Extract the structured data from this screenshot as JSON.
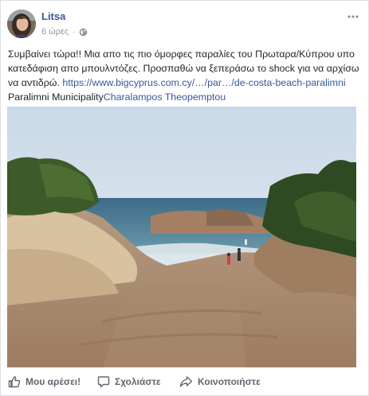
{
  "post": {
    "author": "Litsa",
    "time": "6 ώρες",
    "separator": "·",
    "text_main": "Συμβαίνει τώρα!! Μια απο τις πιο όμορφες παραλίες του Πρωταρα/Κύπρου υπο κατεδάφιση απο μπουλντόζες. Προσπαθώ να ξεπεράσω το shock για να αρχίσω να αντιδρώ. ",
    "link": "https://www.bigcyprus.com.cy/…/par…/de-costa-beach-paralimni",
    "tag1": "Paralimni Municipality",
    "tag2": "Charalampos Theopemptou"
  },
  "actions": {
    "like": "Μου αρέσει!",
    "comment": "Σχολιάστε",
    "share": "Κοινοποιήστε"
  },
  "icons": {
    "more": "more-options-icon",
    "globe": "globe-icon",
    "like": "thumbs-up-icon",
    "comment": "comment-icon",
    "share": "share-arrow-icon"
  },
  "colors": {
    "link": "#365899",
    "muted": "#90949c",
    "action": "#606770"
  }
}
